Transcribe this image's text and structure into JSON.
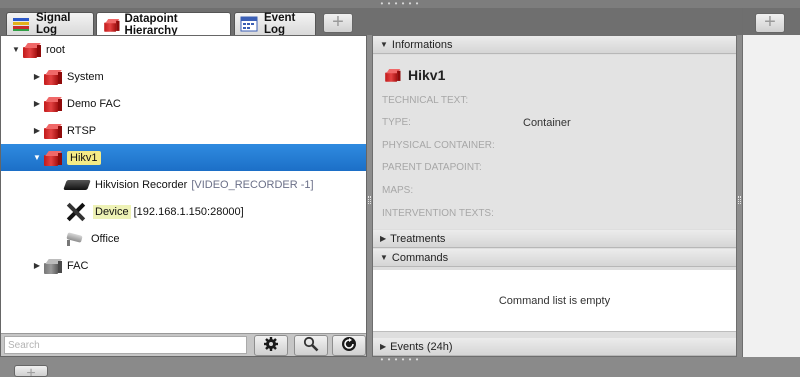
{
  "tabs": [
    {
      "label": "Signal Log",
      "icon": "signal-log-icon"
    },
    {
      "label": "Datapoint Hierarchy",
      "icon": "datapoint-hierarchy-icon",
      "active": true
    },
    {
      "label": "Event Log",
      "icon": "event-log-icon"
    }
  ],
  "add_tab_label": "+",
  "tree": {
    "root": "root",
    "system": "System",
    "demo_fac": "Demo FAC",
    "rtsp": "RTSP",
    "hikv1": "Hikv1",
    "recorder": "Hikvision Recorder",
    "recorder_type": "[VIDEO_RECORDER -1]",
    "device": "Device",
    "device_addr": "[192.168.1.150:28000]",
    "office": "Office",
    "fac": "FAC"
  },
  "search": {
    "placeholder": "Search"
  },
  "informations": {
    "header": "Informations",
    "title": "Hikv1",
    "fields": [
      {
        "label": "TECHNICAL TEXT:",
        "value": ""
      },
      {
        "label": "TYPE:",
        "value": "Container"
      },
      {
        "label": "PHYSICAL CONTAINER:",
        "value": ""
      },
      {
        "label": "PARENT DATAPOINT:",
        "value": ""
      },
      {
        "label": "MAPS:",
        "value": ""
      },
      {
        "label": "INTERVENTION TEXTS:",
        "value": ""
      }
    ]
  },
  "treatments": {
    "header": "Treatments"
  },
  "commands": {
    "header": "Commands",
    "empty_text": "Command list is empty"
  },
  "events": {
    "header": "Events (24h)"
  },
  "colors": {
    "selection": "#1f74cc",
    "highlight": "#f4eb86",
    "accent_red": "#d42a2a"
  }
}
